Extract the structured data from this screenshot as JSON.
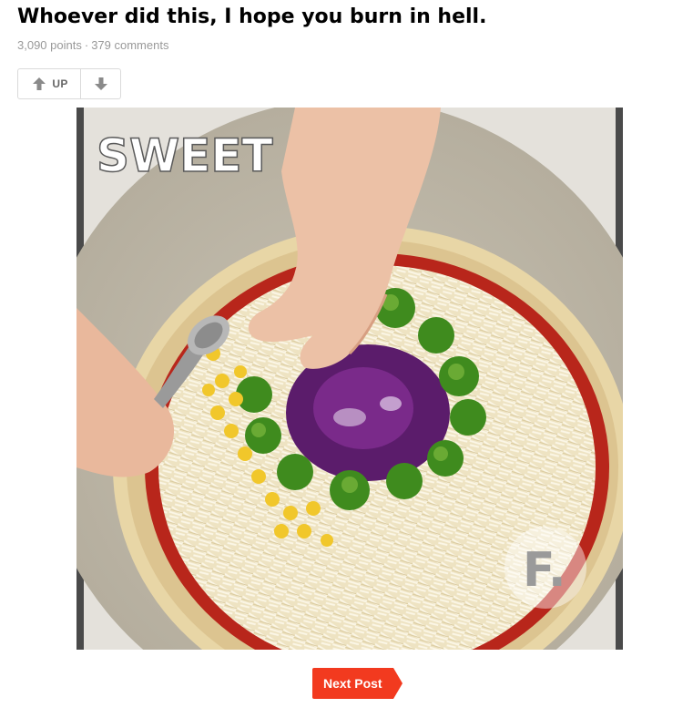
{
  "post": {
    "title": "Whoever did this, I hope you burn in hell.",
    "points": "3,090 points",
    "separator": "·",
    "comments": "379 comments"
  },
  "vote": {
    "up_label": "UP",
    "up_icon": "arrow-up-icon",
    "down_icon": "arrow-down-icon"
  },
  "media": {
    "overlay_text": "SWEET",
    "watermark_letter": "F."
  },
  "nav": {
    "next_label": "Next Post"
  },
  "colors": {
    "accent": "#f23a1f",
    "meta_text": "#999999",
    "border": "#dadada"
  }
}
